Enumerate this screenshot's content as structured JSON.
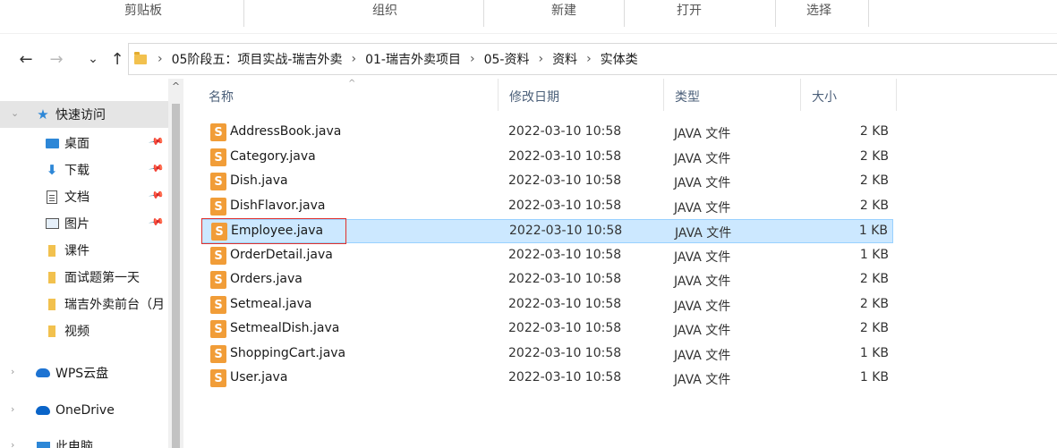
{
  "ribbon": {
    "groups": [
      "剪贴板",
      "组织",
      "新建",
      "打开",
      "选择"
    ]
  },
  "nav_buttons": {
    "back": "←",
    "forward": "→",
    "recent": "⌄",
    "up": "↑"
  },
  "breadcrumb": [
    "05阶段五：项目实战-瑞吉外卖",
    "01-瑞吉外卖项目",
    "05-资料",
    "资料",
    "实体类"
  ],
  "nav_pane": {
    "items": [
      {
        "label": "快速访问",
        "icon": "star-icon"
      },
      {
        "label": "桌面",
        "icon": "desktop-icon",
        "pinned": true
      },
      {
        "label": "下载",
        "icon": "download-icon",
        "pinned": true
      },
      {
        "label": "文档",
        "icon": "document-icon",
        "pinned": true
      },
      {
        "label": "图片",
        "icon": "picture-icon",
        "pinned": true
      },
      {
        "label": "课件",
        "icon": "folder-icon"
      },
      {
        "label": "面试题第一天",
        "icon": "folder-icon"
      },
      {
        "label": "瑞吉外卖前台（月",
        "icon": "folder-icon"
      },
      {
        "label": "视频",
        "icon": "folder-icon"
      },
      {
        "label": "WPS云盘",
        "icon": "cloud-icon"
      },
      {
        "label": "OneDrive",
        "icon": "onedrive-icon"
      },
      {
        "label": "此电脑",
        "icon": "pc-icon"
      }
    ]
  },
  "columns": {
    "name": "名称",
    "date": "修改日期",
    "type": "类型",
    "size": "大小"
  },
  "files": [
    {
      "name": "AddressBook.java",
      "date": "2022-03-10 10:58",
      "type": "JAVA 文件",
      "size": "2 KB"
    },
    {
      "name": "Category.java",
      "date": "2022-03-10 10:58",
      "type": "JAVA 文件",
      "size": "2 KB"
    },
    {
      "name": "Dish.java",
      "date": "2022-03-10 10:58",
      "type": "JAVA 文件",
      "size": "2 KB"
    },
    {
      "name": "DishFlavor.java",
      "date": "2022-03-10 10:58",
      "type": "JAVA 文件",
      "size": "2 KB"
    },
    {
      "name": "Employee.java",
      "date": "2022-03-10 10:58",
      "type": "JAVA 文件",
      "size": "1 KB"
    },
    {
      "name": "OrderDetail.java",
      "date": "2022-03-10 10:58",
      "type": "JAVA 文件",
      "size": "1 KB"
    },
    {
      "name": "Orders.java",
      "date": "2022-03-10 10:58",
      "type": "JAVA 文件",
      "size": "2 KB"
    },
    {
      "name": "Setmeal.java",
      "date": "2022-03-10 10:58",
      "type": "JAVA 文件",
      "size": "2 KB"
    },
    {
      "name": "SetmealDish.java",
      "date": "2022-03-10 10:58",
      "type": "JAVA 文件",
      "size": "2 KB"
    },
    {
      "name": "ShoppingCart.java",
      "date": "2022-03-10 10:58",
      "type": "JAVA 文件",
      "size": "1 KB"
    },
    {
      "name": "User.java",
      "date": "2022-03-10 10:58",
      "type": "JAVA 文件",
      "size": "1 KB"
    }
  ],
  "selected_file": "Employee.java",
  "colors": {
    "selection_bg": "#cce8ff",
    "selection_border": "#99d1ff",
    "highlight_box": "#e0302c",
    "java_icon": "#f19d38"
  }
}
